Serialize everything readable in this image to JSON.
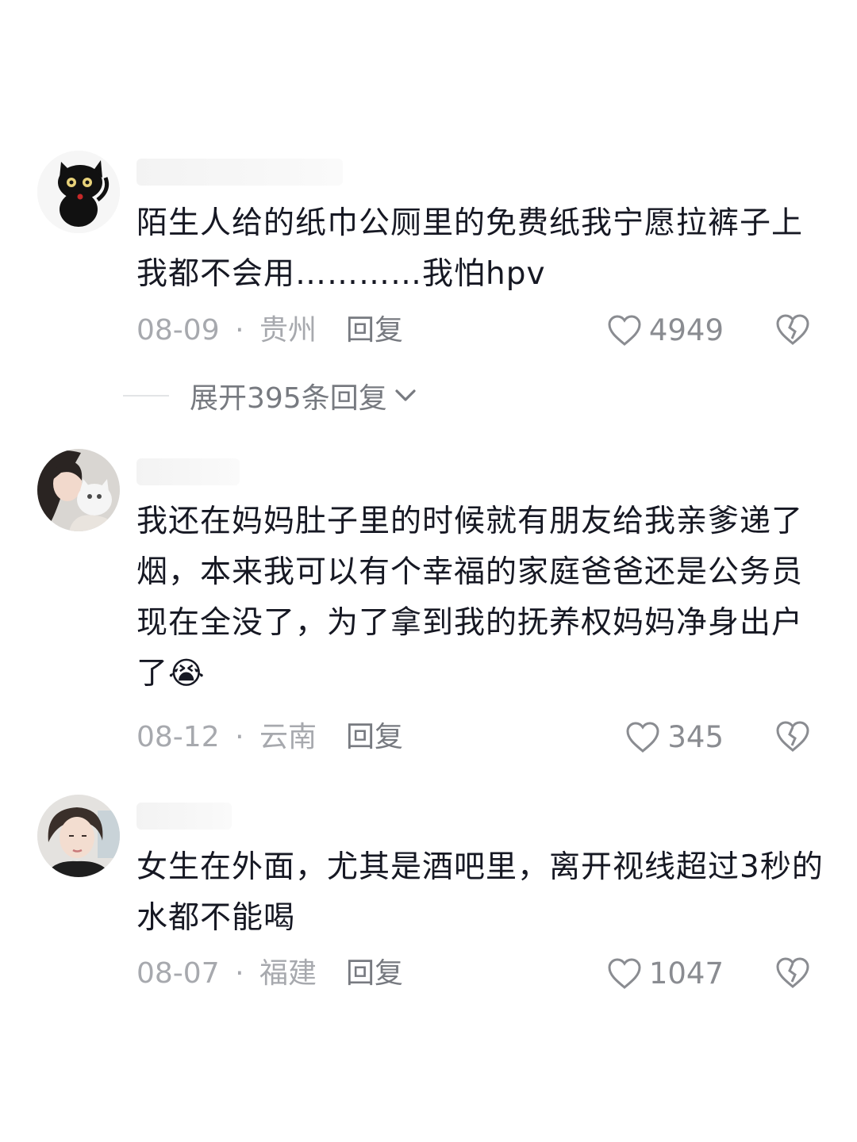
{
  "comments": [
    {
      "text": "陌生人给的纸巾公厕里的免费纸我宁愿拉裤子上我都不会用…………我怕hpv",
      "date": "08-09",
      "separator": "·",
      "location": "贵州",
      "reply_label": "回复",
      "likes": "4949",
      "avatar_icon": "black-cat-avatar"
    },
    {
      "text": "我还在妈妈肚子里的时候就有朋友给我亲爹递了烟，本来我可以有个幸福的家庭爸爸还是公务员现在全没了，为了拿到我的抚养权妈妈净身出户了😭",
      "date": "08-12",
      "separator": "·",
      "location": "云南",
      "reply_label": "回复",
      "likes": "345",
      "avatar_icon": "girl-with-cat-avatar"
    },
    {
      "text": "女生在外面，尤其是酒吧里，离开视线超过3秒的水都不能喝",
      "date": "08-07",
      "separator": "·",
      "location": "福建",
      "reply_label": "回复",
      "likes": "1047",
      "avatar_icon": "woman-portrait-avatar"
    }
  ],
  "expand_replies": {
    "label": "展开395条回复"
  },
  "colors": {
    "text": "#161823",
    "meta": "#a7a9ae",
    "action": "#777a80",
    "background": "#ffffff"
  }
}
